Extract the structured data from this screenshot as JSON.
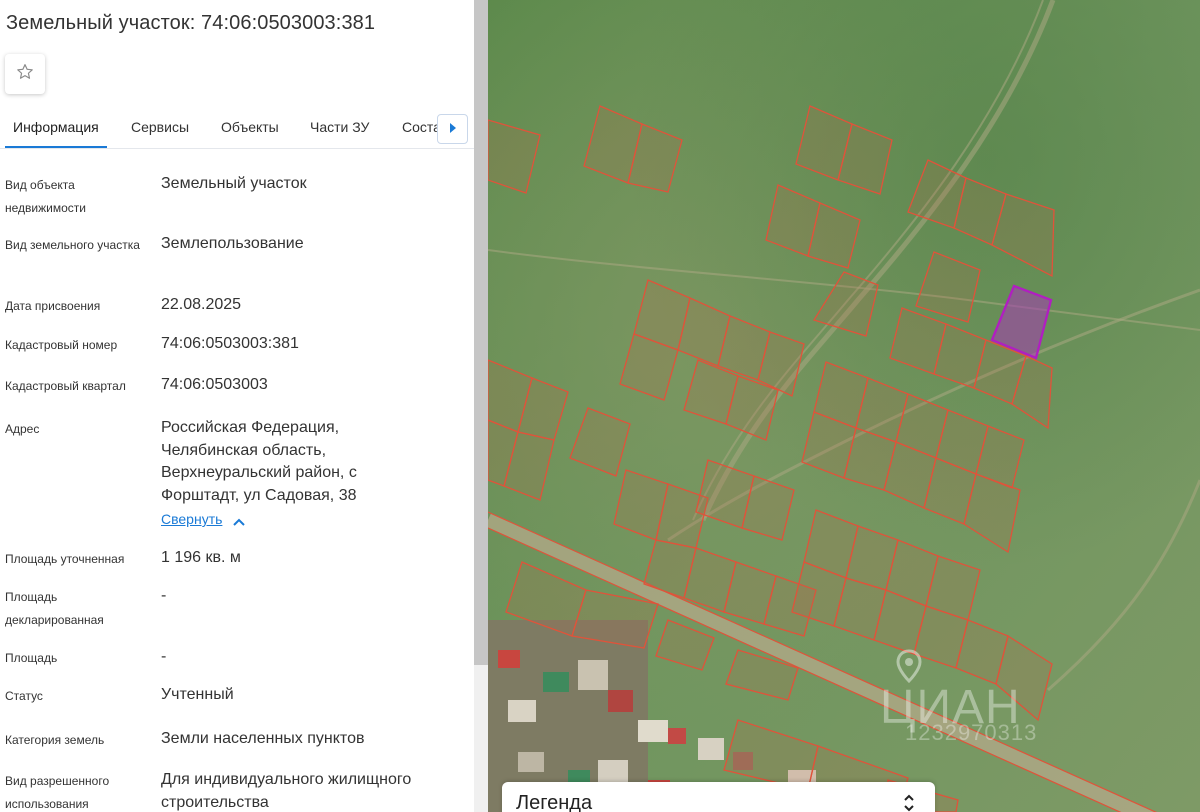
{
  "header": {
    "title": "Земельный участок: 74:06:0503003:381",
    "favorite_icon": "star-outline-icon"
  },
  "tabs": [
    {
      "label": "Информация",
      "active": true
    },
    {
      "label": "Сервисы",
      "active": false
    },
    {
      "label": "Объекты",
      "active": false
    },
    {
      "label": "Части ЗУ",
      "active": false
    },
    {
      "label": "Соста",
      "active": false
    }
  ],
  "tabs_next_icon": "caret-right-icon",
  "info_rows": [
    {
      "label": "Вид объекта недвижимости",
      "value": "Земельный участок"
    },
    {
      "label": "Вид земельного участка",
      "value": "Землепользование"
    },
    {
      "label": "Дата присвоения",
      "value": "22.08.2025"
    },
    {
      "label": "Кадастровый номер",
      "value": "74:06:0503003:381"
    },
    {
      "label": "Кадастровый квартал",
      "value": "74:06:0503003"
    },
    {
      "label": "Адрес",
      "value": "Российская Федерация, Челябинская область, Верхнеуральский район, с Форштадт, ул Садовая, 38"
    },
    {
      "label": "Площадь уточненная",
      "value": "1 196 кв. м"
    },
    {
      "label": "Площадь декларированная",
      "value": "-"
    },
    {
      "label": "Площадь",
      "value": "-"
    },
    {
      "label": "Статус",
      "value": "Учтенный"
    },
    {
      "label": "Категория земель",
      "value": "Земли населенных пунктов"
    },
    {
      "label": "Вид разрешенного использования",
      "value": "Для индивидуального жилищного строительства"
    }
  ],
  "collapse_link": "Свернуть",
  "collapse_icon": "chevron-up-icon",
  "map": {
    "legend_label": "Легенда",
    "legend_icon": "unfold-icon",
    "watermark_text": "ЦИАН",
    "watermark_id": "1232970313",
    "watermark_icon": "map-pin-icon"
  },
  "colors": {
    "accent": "#1a7ad6",
    "parcel_outline": "#e0533a",
    "selected_parcel": "#b01fc0"
  }
}
